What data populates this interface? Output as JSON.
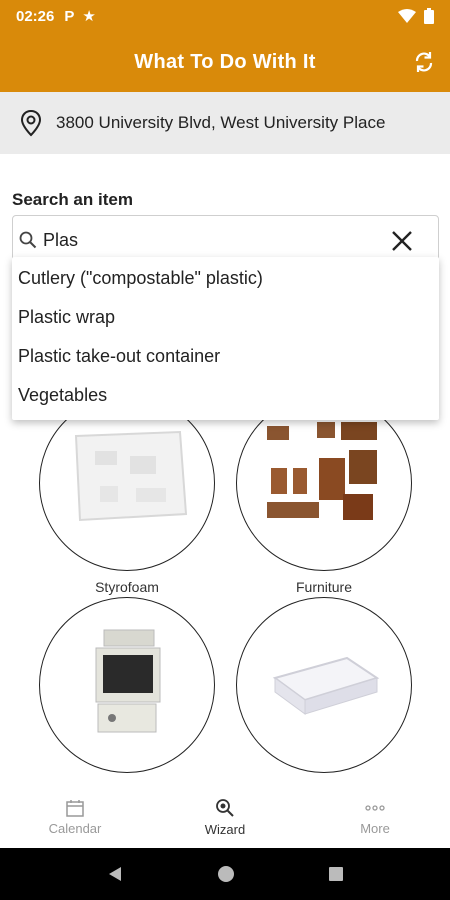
{
  "status_bar": {
    "time": "02:26",
    "icons": [
      "parking-icon",
      "star-icon",
      "wifi-icon",
      "battery-icon"
    ]
  },
  "app_bar": {
    "title": "What To Do With It"
  },
  "location": {
    "address": "3800 University Blvd, West University Place"
  },
  "search": {
    "label": "Search an item",
    "value": "Plas",
    "suggestions": [
      "Cutlery (\"compostable\" plastic)",
      "Plastic wrap",
      "Plastic take-out container",
      "Vegetables"
    ]
  },
  "categories": [
    {
      "label": "Styrofoam",
      "icon": "styrofoam-image"
    },
    {
      "label": "Furniture",
      "icon": "furniture-image"
    },
    {
      "label": "",
      "icon": "computer-image"
    },
    {
      "label": "",
      "icon": "mattress-image"
    }
  ],
  "bottom_nav": [
    {
      "label": "Calendar",
      "icon": "calendar-icon",
      "active": false
    },
    {
      "label": "Wizard",
      "icon": "wizard-icon",
      "active": true
    },
    {
      "label": "More",
      "icon": "more-icon",
      "active": false
    }
  ],
  "colors": {
    "brand": "#d98a0a",
    "location_bg": "#ebebeb"
  }
}
